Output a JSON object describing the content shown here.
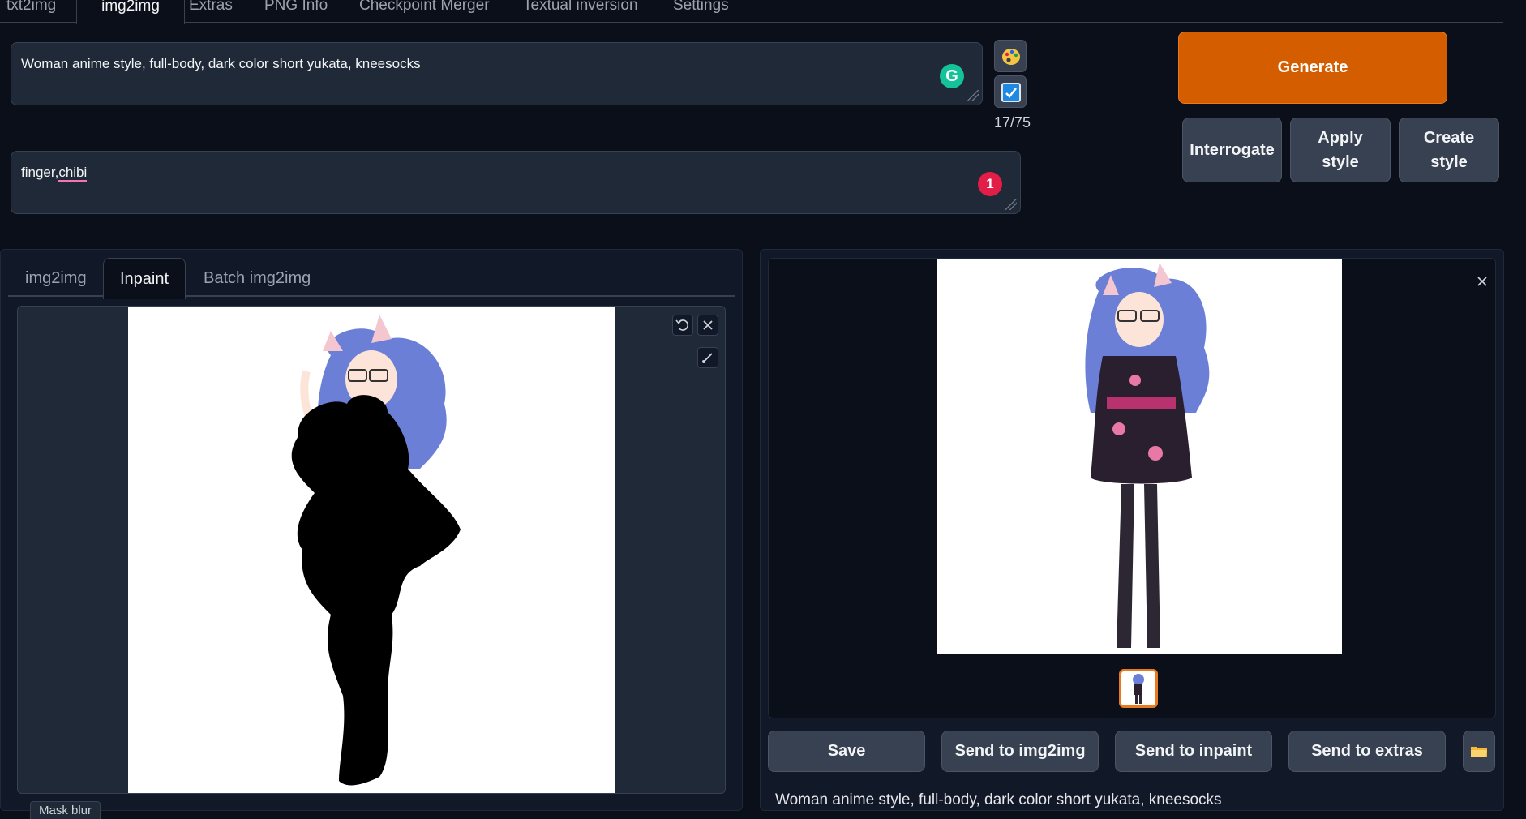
{
  "top_tabs": [
    "txt2img",
    "img2img",
    "Extras",
    "PNG Info",
    "Checkpoint Merger",
    "Textual inversion",
    "Settings"
  ],
  "prompt": {
    "value": "Woman anime style, full-body, dark color short yukata, kneesocks",
    "grammarly": "G"
  },
  "negative_prompt": {
    "value_plain": "finger,",
    "value_flagged": "chibi",
    "issue_count": "1"
  },
  "token_counter": "17/75",
  "buttons": {
    "generate": "Generate",
    "interrogate": "Interrogate",
    "apply_style": "Apply style",
    "create_style": "Create style"
  },
  "mode_tabs": [
    "img2img",
    "Inpaint",
    "Batch img2img"
  ],
  "output_buttons": {
    "save": "Save",
    "send_img2img": "Send to img2img",
    "send_inpaint": "Send to inpaint",
    "send_extras": "Send to extras"
  },
  "output_info": "Woman anime style, full-body, dark color short yukata, kneesocks",
  "mask_blur_label": "Mask blur",
  "colors": {
    "generate": "#d45d00",
    "background": "#0b0f19",
    "panel": "#1f2937"
  }
}
